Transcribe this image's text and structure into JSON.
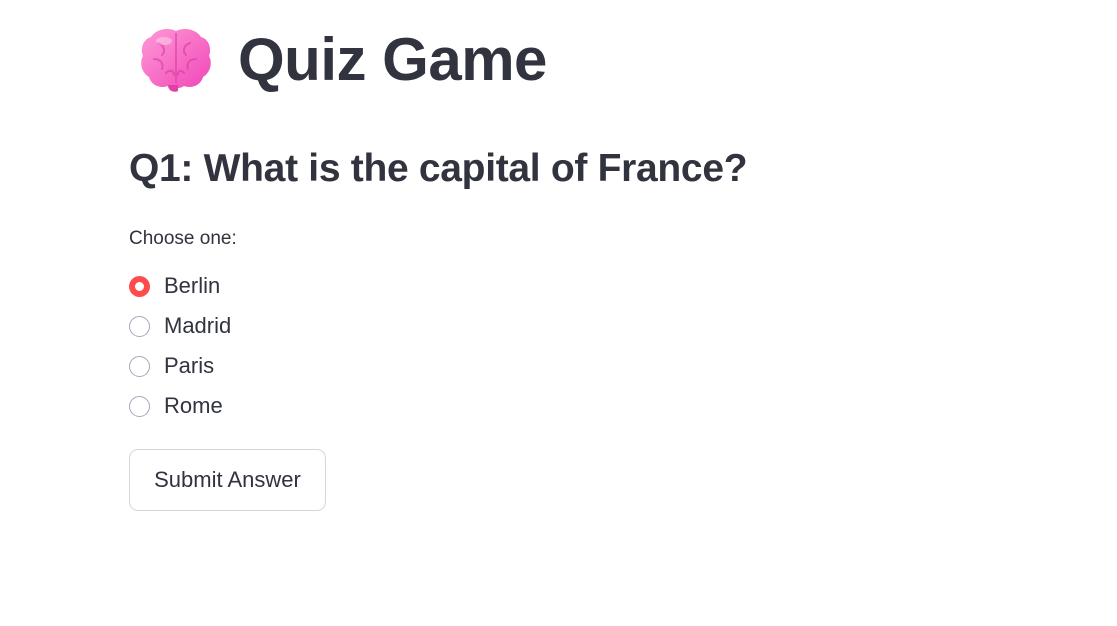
{
  "header": {
    "icon": "brain-icon",
    "title": "Quiz Game"
  },
  "question": {
    "text": "Q1: What is the capital of France?",
    "prompt": "Choose one:",
    "options": [
      {
        "label": "Berlin",
        "selected": true
      },
      {
        "label": "Madrid",
        "selected": false
      },
      {
        "label": "Paris",
        "selected": false
      },
      {
        "label": "Rome",
        "selected": false
      }
    ]
  },
  "actions": {
    "submit_label": "Submit Answer"
  },
  "colors": {
    "accent": "#ff4b4b",
    "text": "#31333f",
    "radio_border": "#a3a8b8",
    "button_border": "#d6d6d9"
  }
}
